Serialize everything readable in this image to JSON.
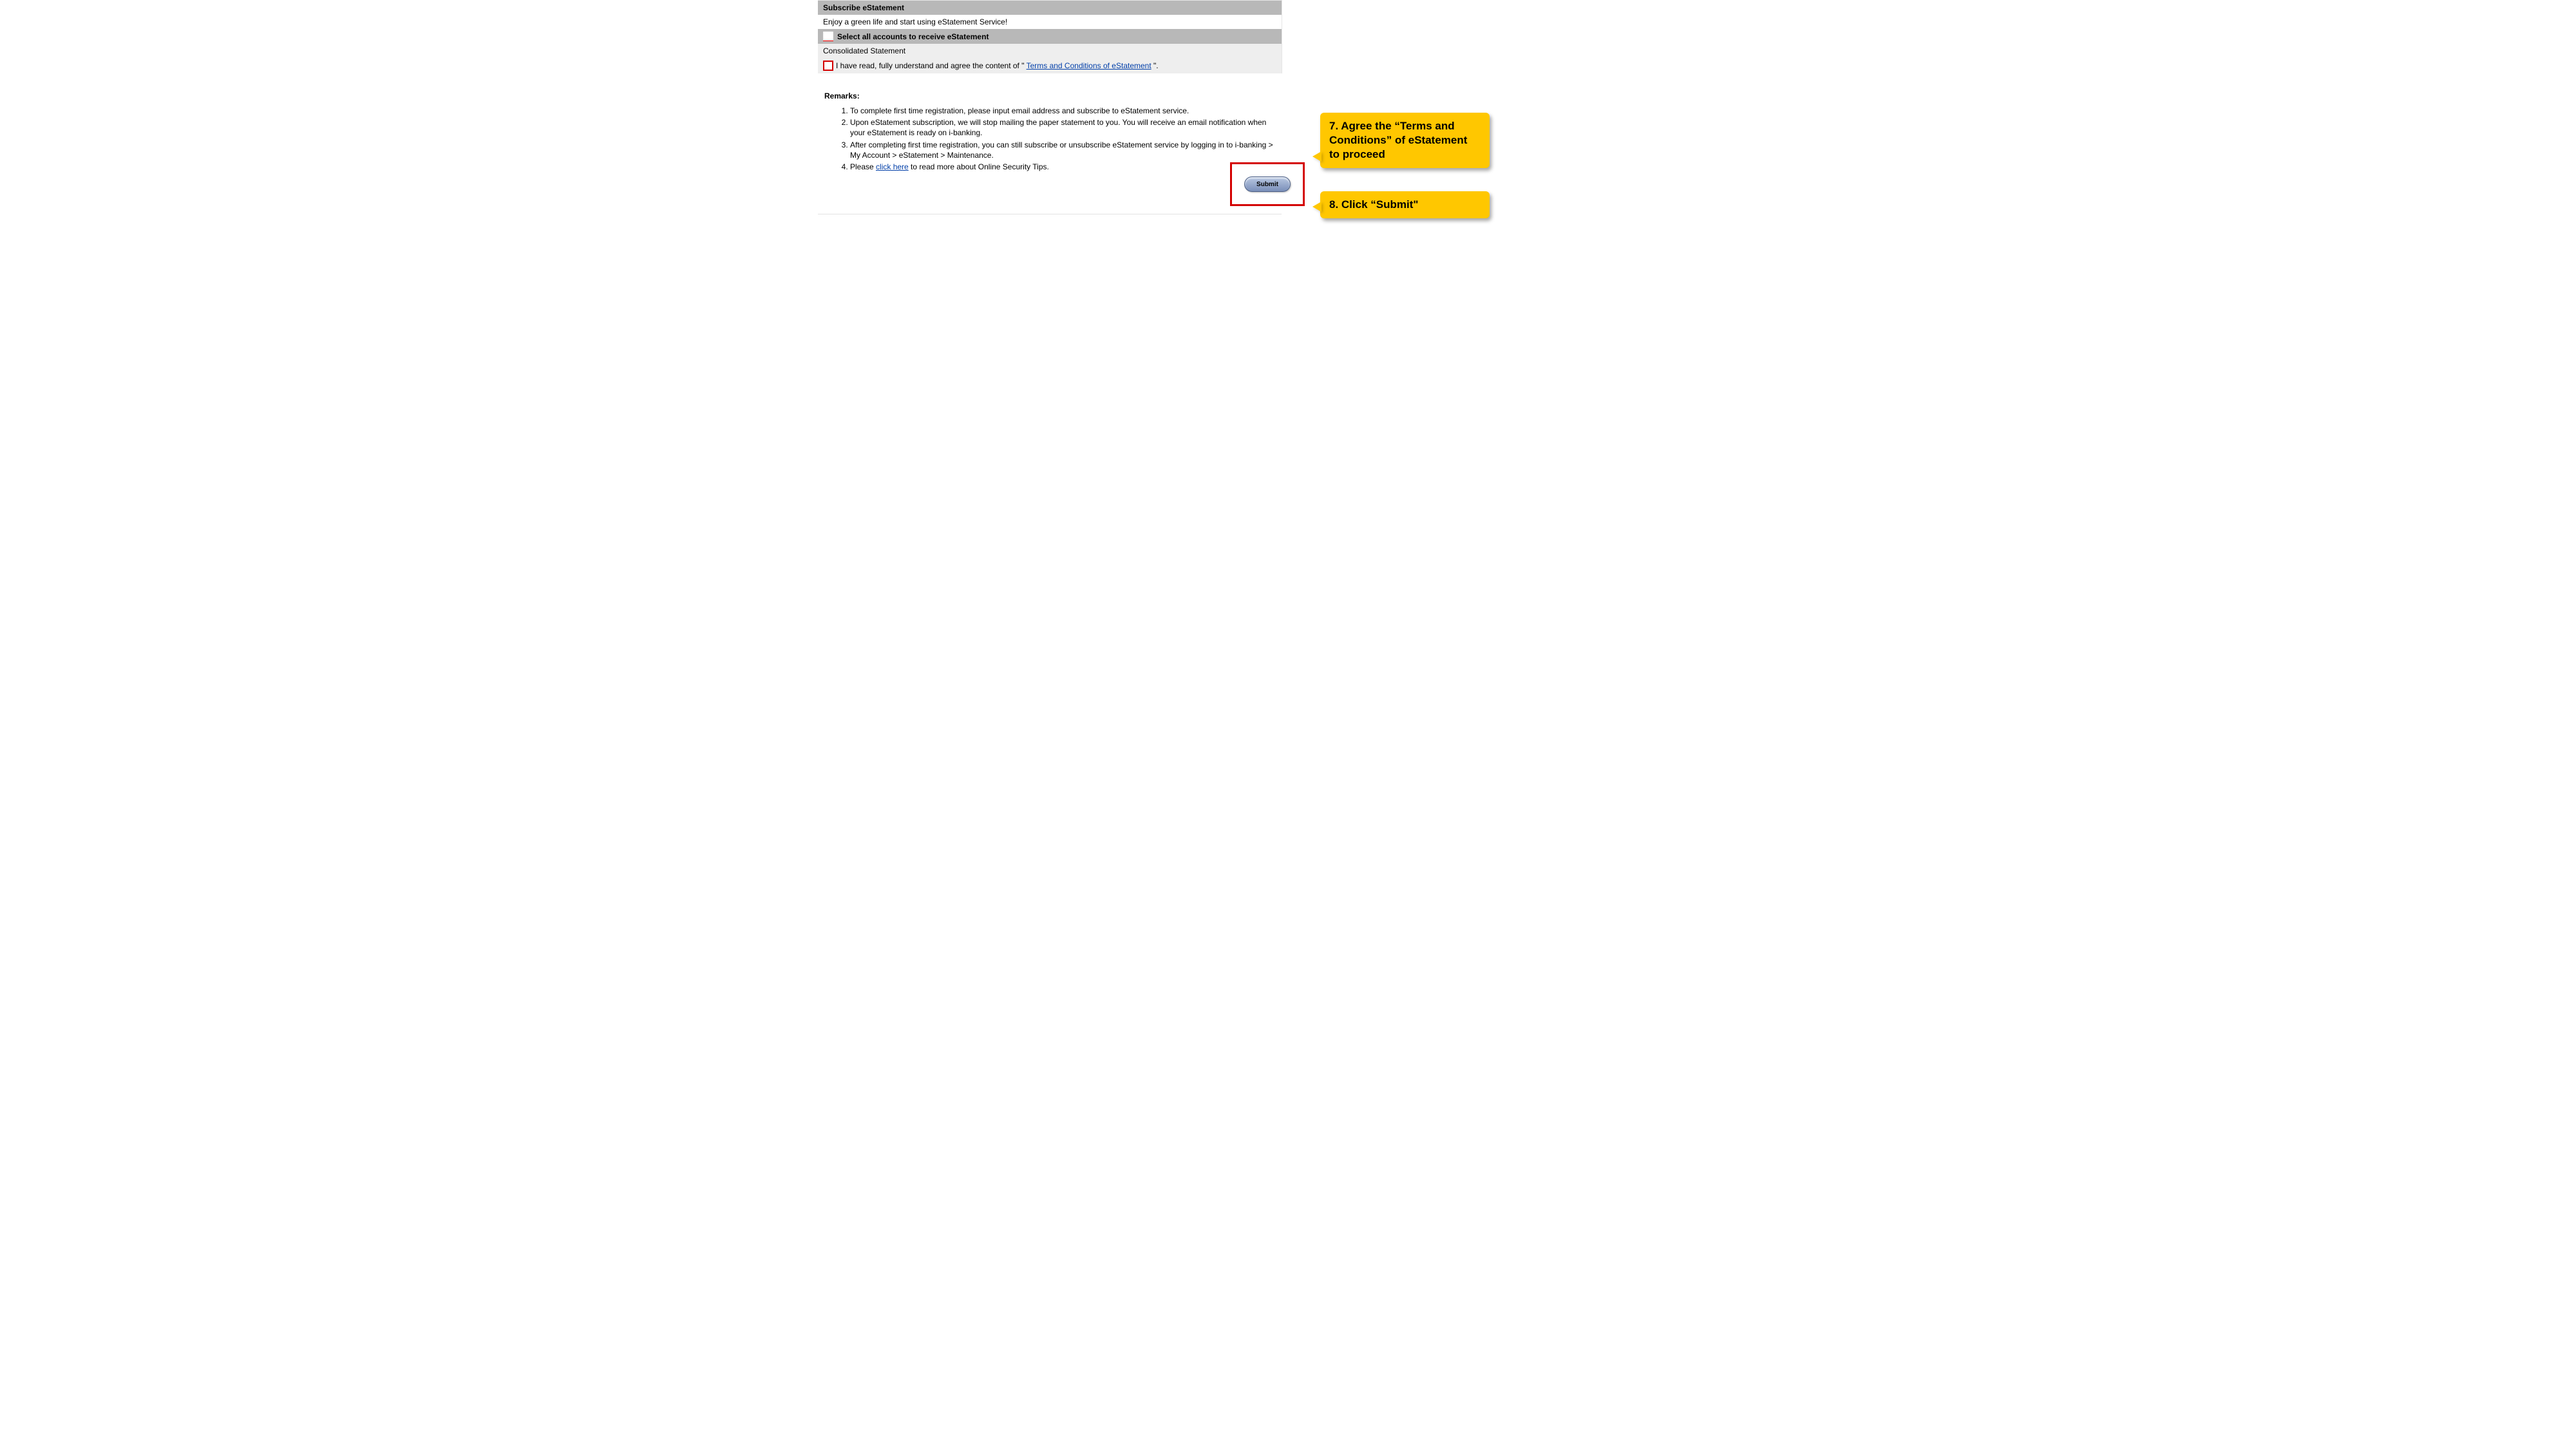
{
  "header": {
    "title": "Subscribe eStatement"
  },
  "intro": "Enjoy a green life and start using eStatement Service!",
  "selectAll": {
    "label": "Select all accounts to receive eStatement"
  },
  "accountRow": "Consolidated Statement",
  "agree": {
    "prefix": "I have read, fully understand and agree the content of \" ",
    "linkText": "Terms and Conditions of eStatement",
    "suffix": " \"."
  },
  "remarks": {
    "title": "Remarks:",
    "items": [
      "To complete first time registration, please input email address and subscribe to eStatement service.",
      "Upon eStatement subscription, we will stop mailing the paper statement to you. You will receive an email notification when your eStatement is ready on i-banking.",
      "After completing first time registration, you can still subscribe or unsubscribe eStatement service by logging in to i-banking > My Account > eStatement > Maintenance.",
      {
        "prefix": "Please  ",
        "linkText": "click here",
        "suffix": "  to read more about Online Security Tips."
      }
    ]
  },
  "submit": {
    "label": "Submit"
  },
  "callouts": {
    "step7": "7. Agree the “Terms and Conditions” of eStatement to proceed",
    "step8": "8. Click “Submit\""
  }
}
